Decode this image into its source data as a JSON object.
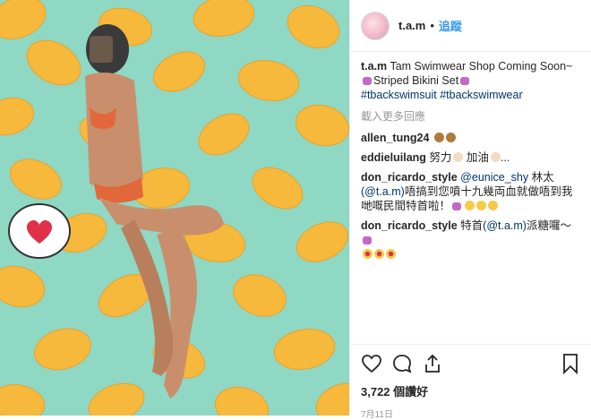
{
  "header": {
    "username": "t.a.m",
    "dot": "•",
    "follow_label": "追蹤"
  },
  "caption": {
    "user": "t.a.m",
    "text1": "Tam Swimwear Shop Coming Soon~",
    "text2": "Striped Bikini Set",
    "hashtags": "#tbackswimsuit #tbackswimwear"
  },
  "load_more": "載入更多回應",
  "comments": [
    {
      "user": "allen_tung24",
      "text": ""
    },
    {
      "user": "eddieluilang",
      "text": "努力",
      "text_b": "加油",
      "text_c": "..."
    },
    {
      "user": "don_ricardo_style",
      "mention1": "@eunice_shy",
      "text": " 林太 ",
      "mention2": "(@t.a.m)",
      "text2": "唔搞到您噴十九幾両血就做唔到我哋嘅民間特首啦！"
    },
    {
      "user": "don_ricardo_style",
      "text": " 特首",
      "mention": "(@t.a.m)",
      "text2": "派糖囉～"
    }
  ],
  "likes": "3,722 個讚好",
  "date": "7月11日",
  "colors": {
    "background": "#8fd8c4",
    "lemon": "#f6b93b",
    "link": "#3897f0"
  }
}
